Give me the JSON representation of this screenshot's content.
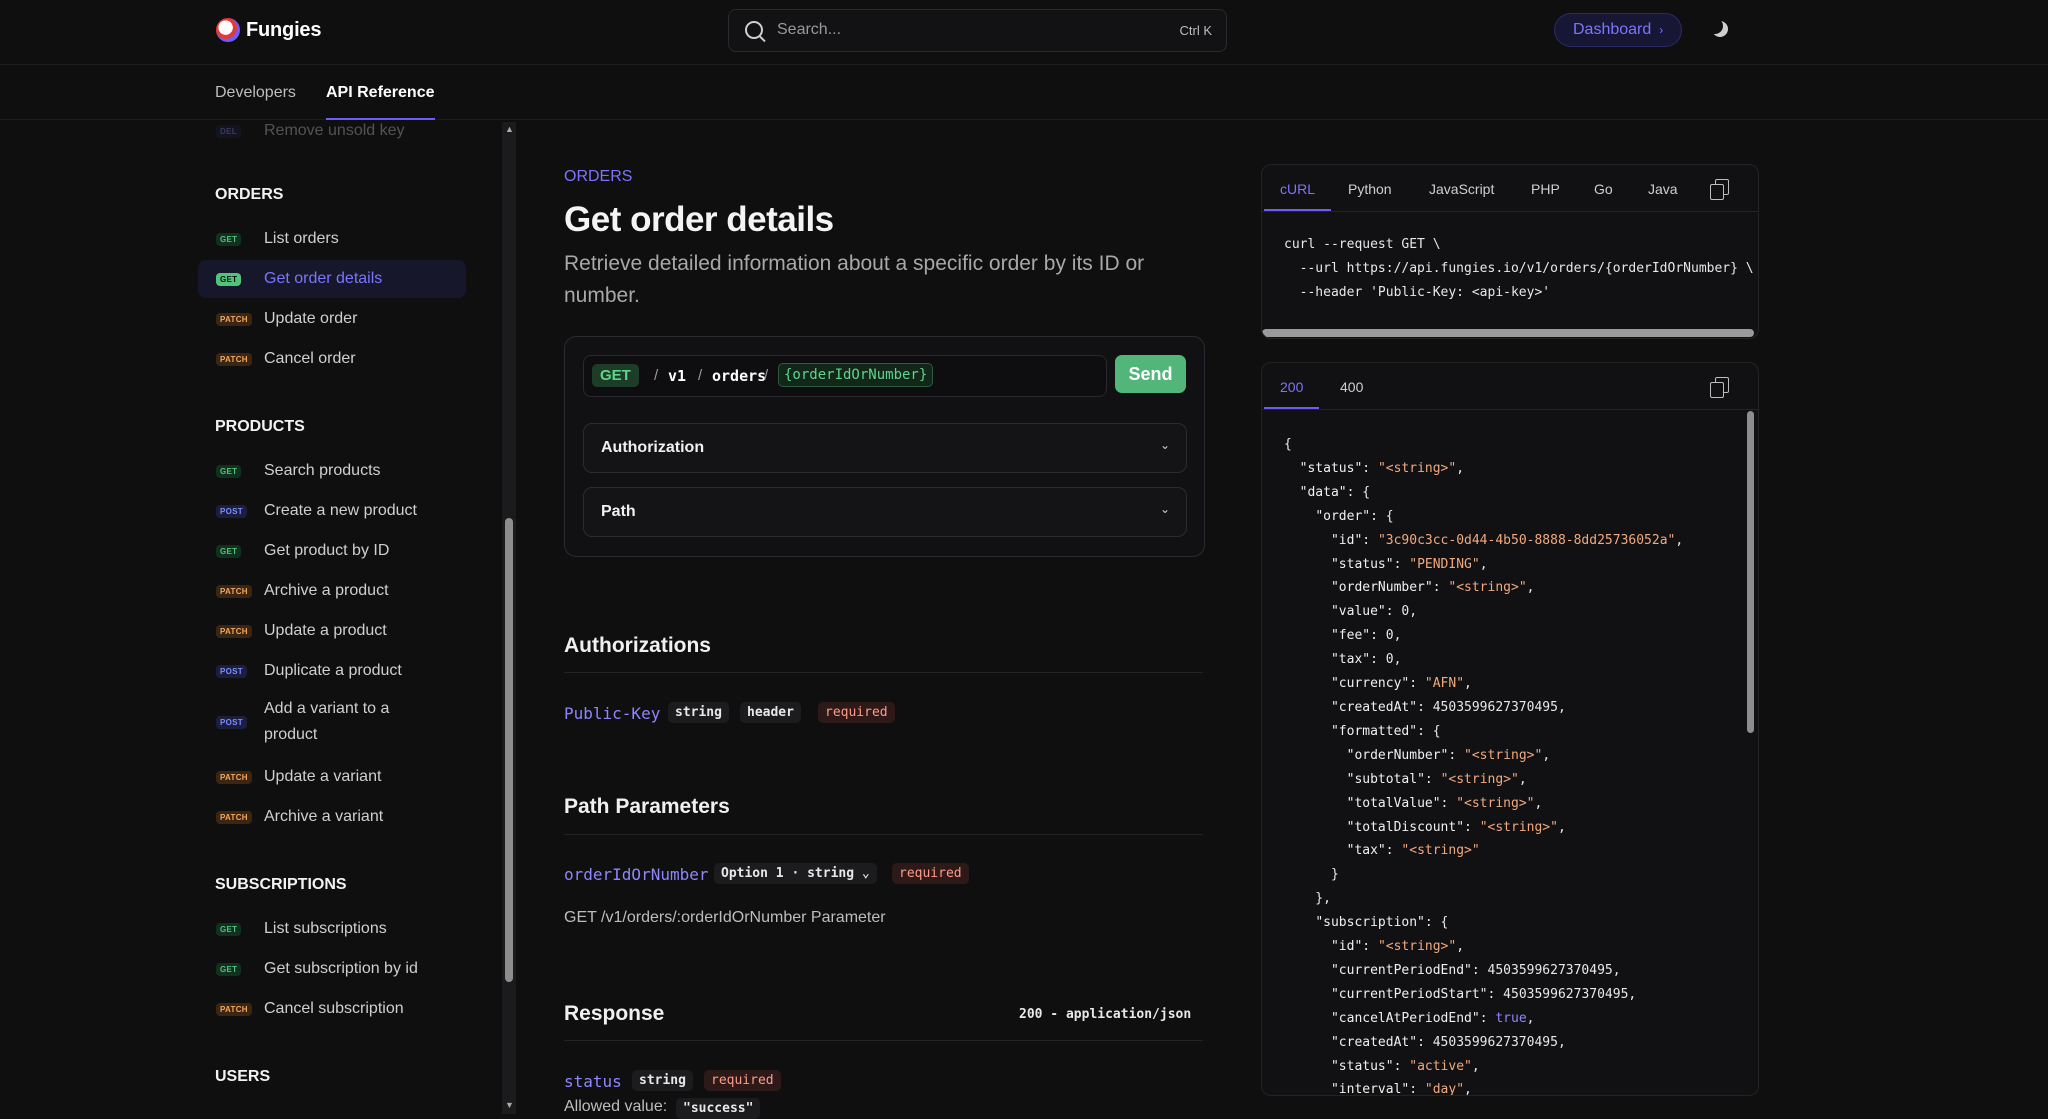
{
  "brand": {
    "name": "Fungies"
  },
  "search": {
    "placeholder": "Search...",
    "shortcut": "Ctrl K"
  },
  "header": {
    "dashboard_label": "Dashboard",
    "dashboard_chevron": "›"
  },
  "nav": {
    "tabs": [
      {
        "label": "Developers"
      },
      {
        "label": "API Reference"
      }
    ]
  },
  "sidebar": {
    "faded_item": "Remove unsold key",
    "sections": [
      {
        "title": "ORDERS",
        "items": [
          {
            "method": "GET",
            "label": "List orders"
          },
          {
            "method": "GET",
            "label": "Get order details",
            "active": true
          },
          {
            "method": "PATCH",
            "label": "Update order"
          },
          {
            "method": "PATCH",
            "label": "Cancel order"
          }
        ]
      },
      {
        "title": "PRODUCTS",
        "items": [
          {
            "method": "GET",
            "label": "Search products"
          },
          {
            "method": "POST",
            "label": "Create a new product"
          },
          {
            "method": "GET",
            "label": "Get product by ID"
          },
          {
            "method": "PATCH",
            "label": "Archive a product"
          },
          {
            "method": "PATCH",
            "label": "Update a product"
          },
          {
            "method": "POST",
            "label": "Duplicate a product"
          },
          {
            "method": "POST",
            "label": "Add a variant to a product"
          },
          {
            "method": "PATCH",
            "label": "Update a variant"
          },
          {
            "method": "PATCH",
            "label": "Archive a variant"
          }
        ]
      },
      {
        "title": "SUBSCRIPTIONS",
        "items": [
          {
            "method": "GET",
            "label": "List subscriptions"
          },
          {
            "method": "GET",
            "label": "Get subscription by id"
          },
          {
            "method": "PATCH",
            "label": "Cancel subscription"
          }
        ]
      },
      {
        "title": "USERS",
        "items": []
      }
    ]
  },
  "main": {
    "breadcrumb": "ORDERS",
    "title": "Get order details",
    "description": "Retrieve detailed information about a specific order by its ID or number.",
    "request": {
      "method": "GET",
      "segments": [
        "v1",
        "orders"
      ],
      "variable": "{orderIdOrNumber}",
      "send_label": "Send"
    },
    "accordions": [
      "Authorization",
      "Path"
    ],
    "authorizations": {
      "heading": "Authorizations",
      "name": "Public-Key",
      "chips": [
        "string",
        "header"
      ],
      "required": "required"
    },
    "path_params": {
      "heading": "Path Parameters",
      "name": "orderIdOrNumber",
      "option_chip": "Option 1 · string",
      "required": "required",
      "description": "GET /v1/orders/:orderIdOrNumber Parameter"
    },
    "response": {
      "heading": "Response",
      "content_type": "200 - application/json",
      "field": "status",
      "type": "string",
      "required": "required",
      "allowed_label": "Allowed value:",
      "allowed_value": "\"success\""
    }
  },
  "code": {
    "tabs": [
      "cURL",
      "Python",
      "JavaScript",
      "PHP",
      "Go",
      "Java"
    ],
    "lines": [
      "curl --request GET \\",
      "  --url https://api.fungies.io/v1/orders/{orderIdOrNumber} \\",
      "  --header 'Public-Key: <api-key>'"
    ]
  },
  "response_panel": {
    "tabs": [
      "200",
      "400"
    ]
  },
  "colors": {
    "accent": "#6b5cff",
    "get": "#51c37a",
    "post": "#7d8cff",
    "patch": "#f5a65b",
    "send": "#52b57a"
  }
}
